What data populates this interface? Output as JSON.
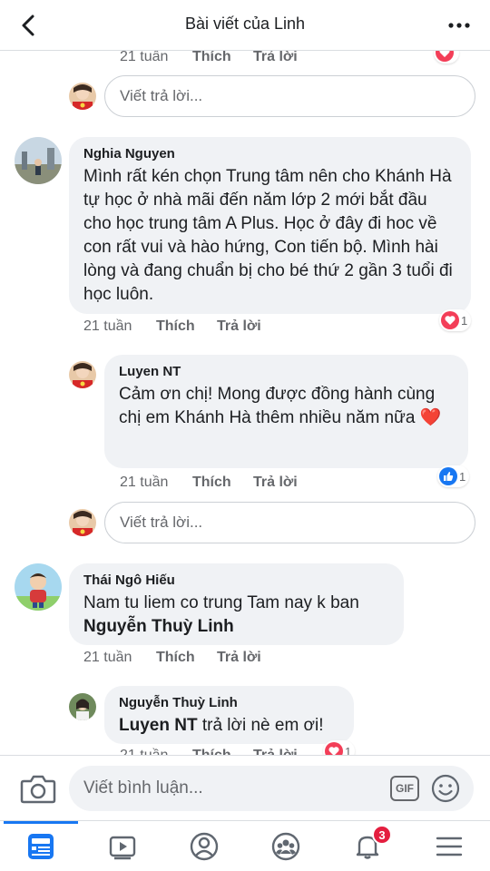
{
  "header": {
    "title": "Bài viết của Linh"
  },
  "top_meta": {
    "time": "21 tuần",
    "like": "Thích",
    "reply": "Trả lời"
  },
  "reply_placeholder": "Viết trả lời...",
  "comments": [
    {
      "author": "Nghia Nguyen",
      "text": "Mình rất kén chọn Trung tâm nên cho Khánh Hà tự học ở nhà mãi đến năm lớp 2 mới bắt đầu cho học trung tâm A Plus. Học ở đây đi hoc về con rất vui và hào hứng, Con tiến bộ. Mình hài lòng và đang chuẩn bị cho bé thứ 2 gần 3 tuổi đi học luôn.",
      "time": "21 tuần",
      "like": "Thích",
      "reply": "Trả lời",
      "reaction": {
        "icon": "heart-reaction-icon",
        "count": "1"
      }
    },
    {
      "author": "Luyen NT",
      "text": "Cảm ơn chị! Mong được đồng hành cùng chị em Khánh Hà thêm nhiều năm nữa",
      "emoji": "❤️",
      "time": "21 tuần",
      "like": "Thích",
      "reply": "Trả lời",
      "reaction": {
        "icon": "like-reaction-icon",
        "count": "1"
      }
    },
    {
      "author": "Thái Ngô Hiếu",
      "text": "Nam tu liem co trung Tam nay k ban",
      "mention": "Nguyễn Thuỳ Linh",
      "time": "21 tuần",
      "like": "Thích",
      "reply": "Trả lời"
    },
    {
      "author": "Nguyễn Thuỳ Linh",
      "mention": "Luyen NT",
      "text": "trả lời nè em ơi!",
      "time": "21 tuần",
      "like": "Thích",
      "reply": "Trả lời",
      "reaction": {
        "icon": "heart-reaction-icon",
        "count": "1"
      }
    }
  ],
  "composer": {
    "placeholder": "Viết bình luận...",
    "gif_label": "GIF"
  },
  "navbar": {
    "items": [
      "news-feed",
      "watch",
      "profile",
      "groups",
      "notifications",
      "menu"
    ],
    "notifications_badge": "3"
  },
  "colors": {
    "accent": "#1877f2",
    "bubble": "#f0f2f5",
    "meta": "#65676b",
    "badge": "#e41e3f"
  }
}
